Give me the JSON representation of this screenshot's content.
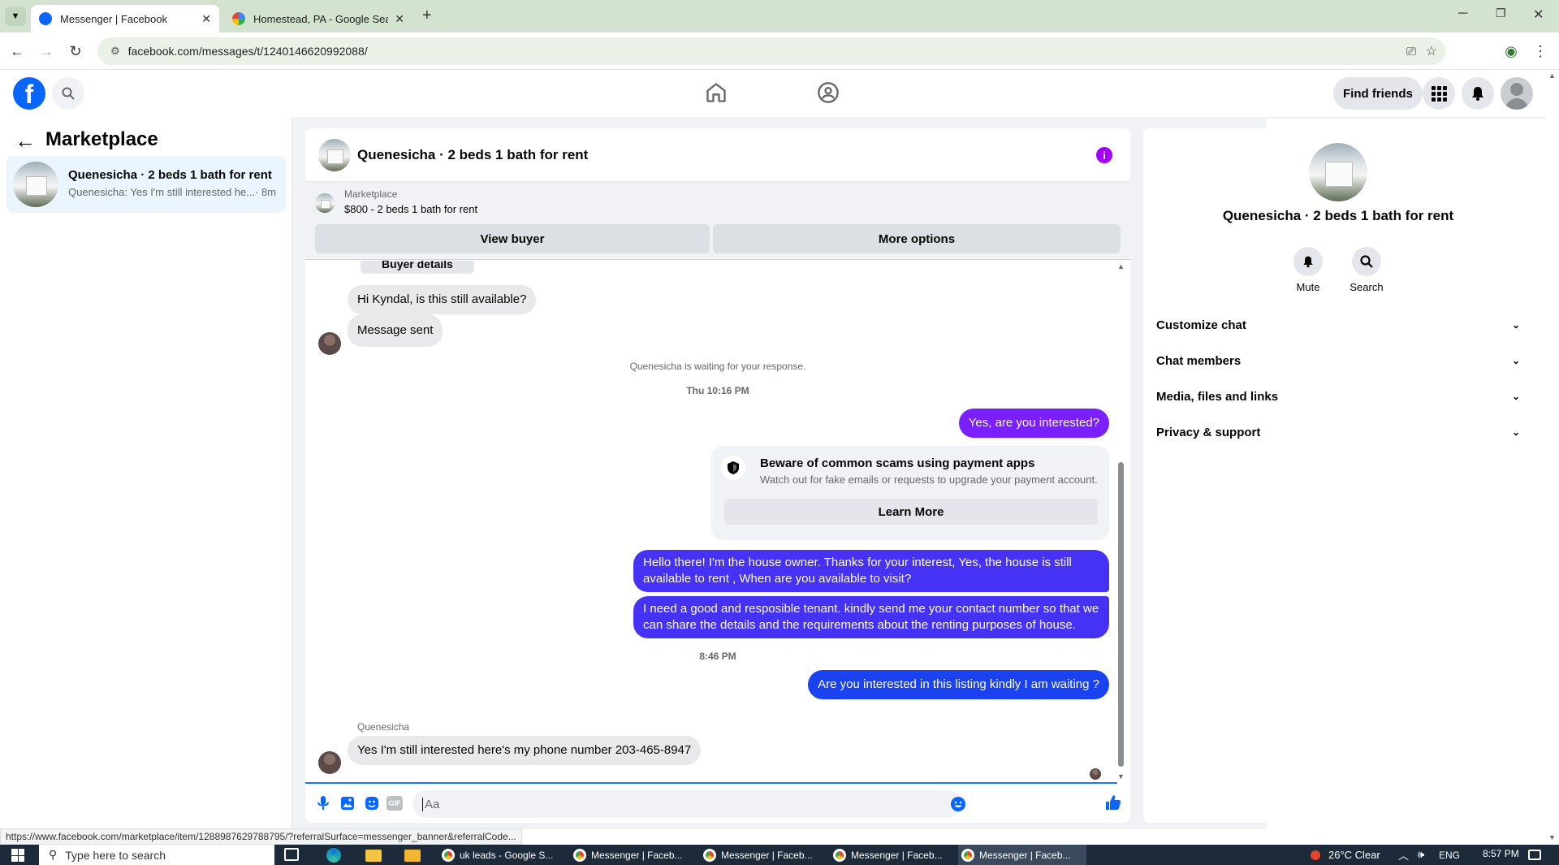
{
  "browser": {
    "tabs": [
      {
        "title": "Messenger | Facebook"
      },
      {
        "title": "Homestead, PA - Google Search"
      }
    ],
    "url": "facebook.com/messages/t/1240146620992088/",
    "status_url": "https://www.facebook.com/marketplace/item/1288987629788795/?referralSurface=messenger_banner&referralCode..."
  },
  "fb": {
    "find_friends": "Find friends"
  },
  "left": {
    "title": "Marketplace",
    "conversation": {
      "name": "Quenesicha · 2 beds 1 bath for rent",
      "preview": "Quenesicha: Yes I'm still interested he...",
      "time": "· 8m"
    }
  },
  "chat": {
    "title": "Quenesicha · 2 beds 1 bath for rent",
    "listing": {
      "source": "Marketplace",
      "summary": "$800 - 2 beds 1 bath for rent",
      "view_buyer": "View buyer",
      "more_options": "More options"
    },
    "buyer_details": "Buyer details",
    "msg1": "Hi Kyndal, is this still available?",
    "msg2": "Message sent",
    "waiting": "Quenesicha is waiting for your response.",
    "time1": "Thu 10:16 PM",
    "out1": "Yes, are you interested?",
    "scam_title": "Beware of common scams using payment apps",
    "scam_body": "Watch out for fake emails or requests to upgrade your payment account.",
    "learn_more": "Learn More",
    "out2": "Hello there! I'm the house owner. Thanks for your interest, Yes, the house is still available to rent , When are you available to visit?",
    "out3": "I need a good and resposible tenant.  kindly send me your contact number so that we can share the details and the requirements about the renting purposes of house.",
    "time2": "8:46 PM",
    "out4": "Are you interested in this listing kindly I am waiting ?",
    "sender_name": "Quenesicha",
    "in_last": "Yes I'm still interested here's  my phone number 203-465-8947",
    "composer_placeholder": "Aa"
  },
  "right": {
    "name": "Quenesicha · 2 beds 1 bath for rent",
    "mute": "Mute",
    "search": "Search",
    "sections": [
      "Customize chat",
      "Chat members",
      "Media, files and links",
      "Privacy & support"
    ]
  },
  "taskbar": {
    "search_placeholder": "Type here to search",
    "apps": [
      "uk leads - Google S...",
      "Messenger | Faceb...",
      "Messenger | Faceb...",
      "Messenger | Faceb...",
      "Messenger | Faceb..."
    ],
    "weather": "26°C  Clear",
    "lang": "ENG",
    "clock": "8:57 PM"
  },
  "colors": {
    "fb_blue": "#0866ff",
    "messenger_purple": "#5b2ff7",
    "info_purple": "#a100ff"
  }
}
